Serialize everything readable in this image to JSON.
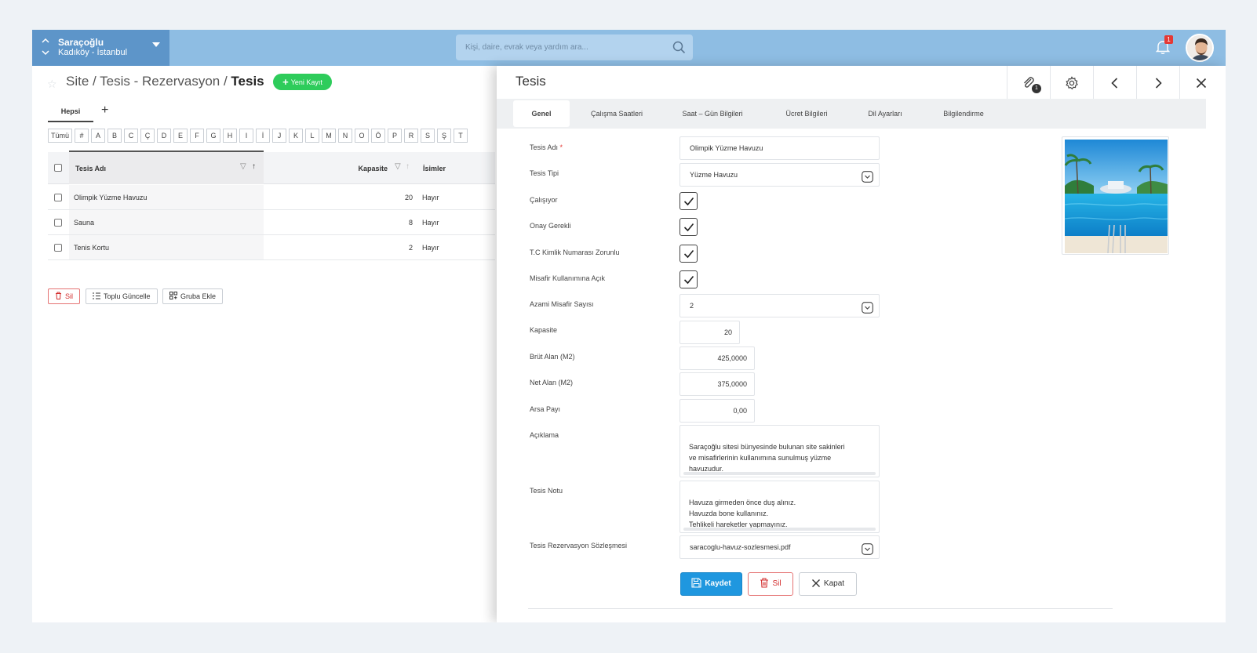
{
  "site": {
    "name": "Saraçoğlu",
    "location": "Kadıköy - İstanbul"
  },
  "search": {
    "placeholder": "Kişi, daire, evrak veya yardım ara..."
  },
  "notifications": {
    "count": "1"
  },
  "breadcrumb": {
    "part1": "Site",
    "sep1": " / ",
    "part2": "Tesis - Rezervasyon",
    "sep2": " / ",
    "current": "Tesis"
  },
  "new_button": {
    "label": "Yeni Kayıt"
  },
  "list_tabs": {
    "all": "Hepsi",
    "add": "+"
  },
  "alphabet": [
    "Tümü",
    "#",
    "A",
    "B",
    "C",
    "Ç",
    "D",
    "E",
    "F",
    "G",
    "H",
    "I",
    "İ",
    "J",
    "K",
    "L",
    "M",
    "N",
    "O",
    "Ö",
    "P",
    "R",
    "S",
    "Ş",
    "T"
  ],
  "table": {
    "headers": {
      "name": "Tesis Adı",
      "capacity": "Kapasite",
      "names": "İsimler"
    },
    "rows": [
      {
        "name": "Olimpik Yüzme Havuzu",
        "capacity": "20",
        "names": "Hayır"
      },
      {
        "name": "Sauna",
        "capacity": "8",
        "names": "Hayır"
      },
      {
        "name": "Tenis Kortu",
        "capacity": "2",
        "names": "Hayır"
      }
    ]
  },
  "list_actions": {
    "delete": "Sil",
    "bulk_update": "Toplu Güncelle",
    "add_group": "Gruba Ekle"
  },
  "panel": {
    "title": "Tesis",
    "attachment_count": "1",
    "tabs": [
      "Genel",
      "Çalışma Saatleri",
      "Saat – Gün Bilgileri",
      "Ücret Bilgileri",
      "Dil Ayarları",
      "Bilgilendirme"
    ],
    "fields": {
      "name_label": "Tesis Adı",
      "name_required": "*",
      "name_value": "Olimpik Yüzme Havuzu",
      "type_label": "Tesis Tipi",
      "type_value": "Yüzme Havuzu",
      "working_label": "Çalışıyor",
      "approval_label": "Onay Gerekli",
      "tckn_label": "T.C Kimlik Numarası Zorunlu",
      "guest_label": "Misafir Kullanımına Açık",
      "max_guest_label": "Azami Misafir Sayısı",
      "max_guest_value": "2",
      "capacity_label": "Kapasite",
      "capacity_value": "20",
      "gross_label": "Brüt Alan (M2)",
      "gross_value": "425,0000",
      "net_label": "Net Alan (M2)",
      "net_value": "375,0000",
      "share_label": "Arsa Payı",
      "share_value": "0,00",
      "desc_label": "Açıklama",
      "desc_value": "Saraçoğlu sitesi bünyesinde bulunan site sakinleri\nve misafirlerinin kullanımına sunulmuş yüzme\nhavuzudur.",
      "note_label": "Tesis Notu",
      "note_value": "Havuza girmeden önce duş alınız.\nHavuzda bone kullanınız.\nTehlikeli hareketler yapmayınız.",
      "contract_label": "Tesis Rezervasyon Sözleşmesi",
      "contract_value": "saracoglu-havuz-sozlesmesi.pdf"
    },
    "buttons": {
      "save": "Kaydet",
      "delete": "Sil",
      "close": "Kapat"
    }
  },
  "colors": {
    "topbar": "#8ebde3",
    "site_selector": "#5d95c9",
    "primary": "#1f97df",
    "success": "#2ecc5b",
    "danger": "#d32f2f"
  }
}
